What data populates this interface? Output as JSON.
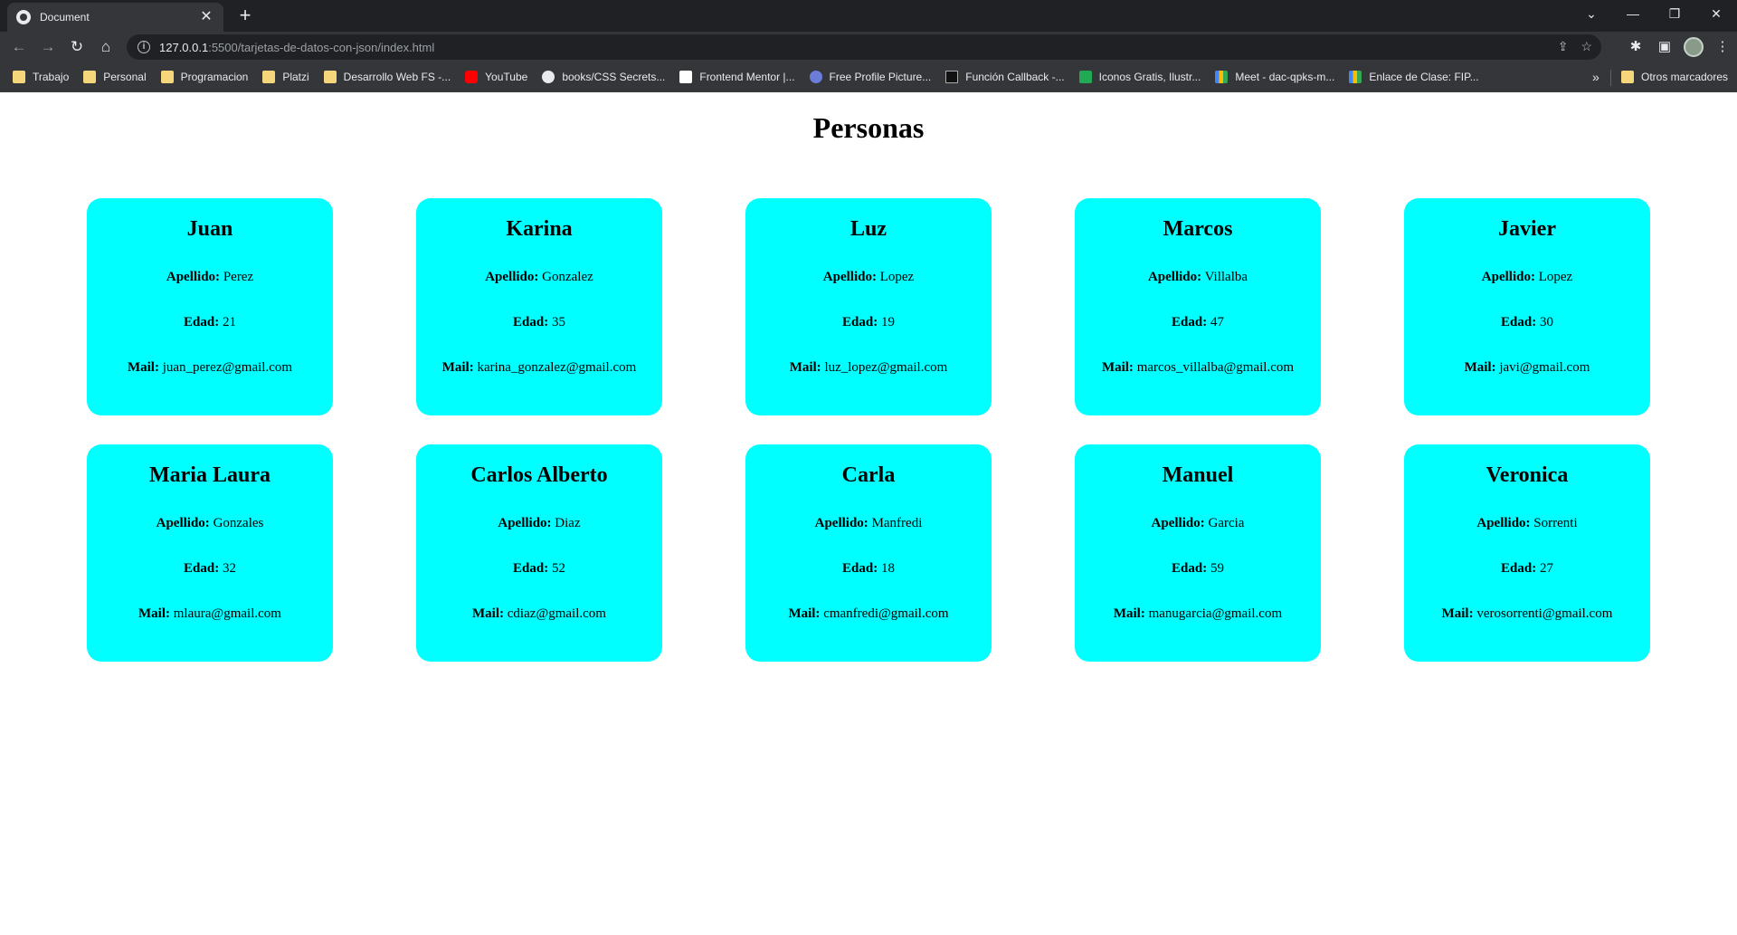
{
  "browser": {
    "tab_title": "Document",
    "url_host": "127.0.0.1",
    "url_rest": ":5500/tarjetas-de-datos-con-json/index.html",
    "bookmarks": [
      {
        "label": "Trabajo",
        "icon": "folder-icon"
      },
      {
        "label": "Personal",
        "icon": "folder-icon"
      },
      {
        "label": "Programacion",
        "icon": "folder-icon"
      },
      {
        "label": "Platzi",
        "icon": "folder-icon"
      },
      {
        "label": "Desarrollo Web FS -...",
        "icon": "folder-icon"
      },
      {
        "label": "YouTube",
        "icon": "youtube-icon"
      },
      {
        "label": "books/CSS Secrets...",
        "icon": "github-icon"
      },
      {
        "label": "Frontend Mentor |...",
        "icon": "frontend-mentor-icon"
      },
      {
        "label": "Free Profile Picture...",
        "icon": "profile-picture-icon"
      },
      {
        "label": "Función Callback -...",
        "icon": "m-icon"
      },
      {
        "label": "Iconos Gratis, Ilustr...",
        "icon": "iconos-icon"
      },
      {
        "label": "Meet - dac-qpks-m...",
        "icon": "meet-icon"
      },
      {
        "label": "Enlace de Clase: FIP...",
        "icon": "meet-icon"
      }
    ],
    "other_bookmarks": "Otros marcadores"
  },
  "page": {
    "title": "Personas",
    "labels": {
      "apellido": "Apellido:",
      "edad": "Edad:",
      "mail": "Mail:"
    },
    "people": [
      {
        "nombre": "Juan",
        "apellido": "Perez",
        "edad": "21",
        "mail": "juan_perez@gmail.com"
      },
      {
        "nombre": "Karina",
        "apellido": "Gonzalez",
        "edad": "35",
        "mail": "karina_gonzalez@gmail.com"
      },
      {
        "nombre": "Luz",
        "apellido": "Lopez",
        "edad": "19",
        "mail": "luz_lopez@gmail.com"
      },
      {
        "nombre": "Marcos",
        "apellido": "Villalba",
        "edad": "47",
        "mail": "marcos_villalba@gmail.com"
      },
      {
        "nombre": "Javier",
        "apellido": "Lopez",
        "edad": "30",
        "mail": "javi@gmail.com"
      },
      {
        "nombre": "Maria Laura",
        "apellido": "Gonzales",
        "edad": "32",
        "mail": "mlaura@gmail.com"
      },
      {
        "nombre": "Carlos Alberto",
        "apellido": "Diaz",
        "edad": "52",
        "mail": "cdiaz@gmail.com"
      },
      {
        "nombre": "Carla",
        "apellido": "Manfredi",
        "edad": "18",
        "mail": "cmanfredi@gmail.com"
      },
      {
        "nombre": "Manuel",
        "apellido": "Garcia",
        "edad": "59",
        "mail": "manugarcia@gmail.com"
      },
      {
        "nombre": "Veronica",
        "apellido": "Sorrenti",
        "edad": "27",
        "mail": "verosorrenti@gmail.com"
      }
    ]
  },
  "colors": {
    "card_background": "#00ffff",
    "page_background": "#ffffff",
    "chrome_dark": "#202124",
    "chrome_toolbar": "#35363a"
  }
}
